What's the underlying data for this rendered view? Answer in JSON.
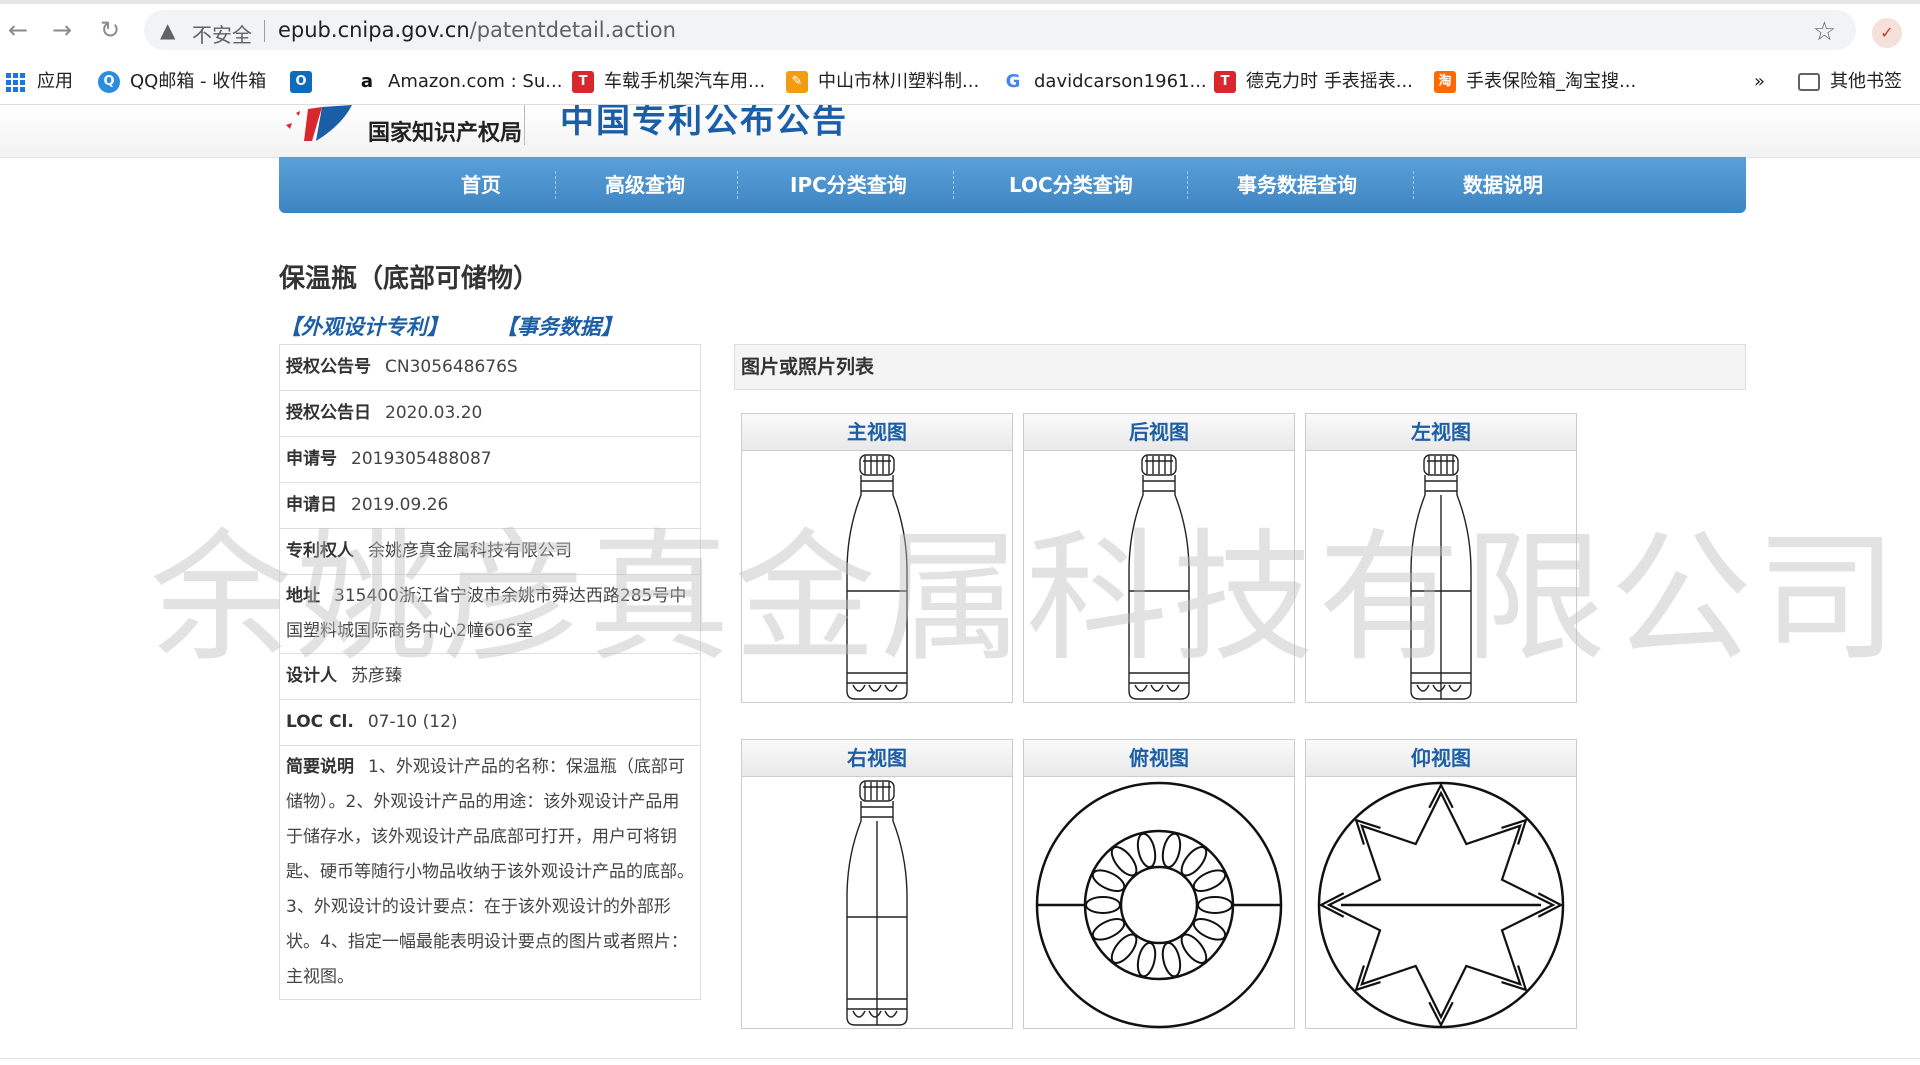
{
  "browser": {
    "security_label": "不安全",
    "url_host": "epub.cnipa.gov.cn",
    "url_path": "/patentdetail.action",
    "bookmarks": [
      {
        "label": "应用",
        "icon": "apps-grid-icon"
      },
      {
        "label": "QQ邮箱 - 收件箱",
        "icon": "qq-mail-icon"
      },
      {
        "label": "",
        "icon": "outlook-icon"
      },
      {
        "label": "Amazon.com : Su...",
        "icon": "amazon-icon"
      },
      {
        "label": "车载手机架汽车用...",
        "icon": "tmall-icon"
      },
      {
        "label": "中山市林川塑料制...",
        "icon": "alibaba-icon"
      },
      {
        "label": "davidcarson1961...",
        "icon": "google-icon"
      },
      {
        "label": "德克力时 手表摇表...",
        "icon": "tmall-icon"
      },
      {
        "label": "手表保险箱_淘宝搜...",
        "icon": "taobao-icon"
      }
    ],
    "overflow_label": "»",
    "other_bookmarks": "其他书签"
  },
  "site": {
    "org_name": "国家知识产权局",
    "site_title": "中国专利公布公告"
  },
  "nav": [
    "首页",
    "高级查询",
    "IPC分类查询",
    "LOC分类查询",
    "事务数据查询",
    "数据说明"
  ],
  "patent": {
    "title": "保温瓶（底部可储物）",
    "type_link": "【外观设计专利】",
    "data_link": "【事务数据】",
    "fields": [
      {
        "key": "授权公告号",
        "value": "CN305648676S"
      },
      {
        "key": "授权公告日",
        "value": "2020.03.20"
      },
      {
        "key": "申请号",
        "value": "2019305488087"
      },
      {
        "key": "申请日",
        "value": "2019.09.26"
      },
      {
        "key": "专利权人",
        "value": "余姚彦真金属科技有限公司"
      },
      {
        "key": "地址",
        "value": "315400浙江省宁波市余姚市舜达西路285号中国塑料城国际商务中心2幢606室"
      },
      {
        "key": "设计人",
        "value": "苏彦臻"
      },
      {
        "key": "LOC Cl.",
        "value": "07-10 (12)"
      },
      {
        "key": "简要说明",
        "value": "1、外观设计产品的名称：保温瓶（底部可储物）。2、外观设计产品的用途：该外观设计产品用于储存水，该外观设计产品底部可打开，用户可将钥匙、硬币等随行小物品收纳于该外观设计产品的底部。3、外观设计的设计要点：在于该外观设计的外部形状。4、指定一幅最能表明设计要点的图片或者照片：主视图。"
      }
    ]
  },
  "images": {
    "header": "图片或照片列表",
    "views": [
      "主视图",
      "后视图",
      "左视图",
      "右视图",
      "俯视图",
      "仰视图"
    ]
  },
  "watermark": "余姚彦真金属科技有限公司",
  "colors": {
    "nav_bg": "#4a93cf",
    "link": "#1d5fa6",
    "title_blue": "#1b5ea8"
  }
}
